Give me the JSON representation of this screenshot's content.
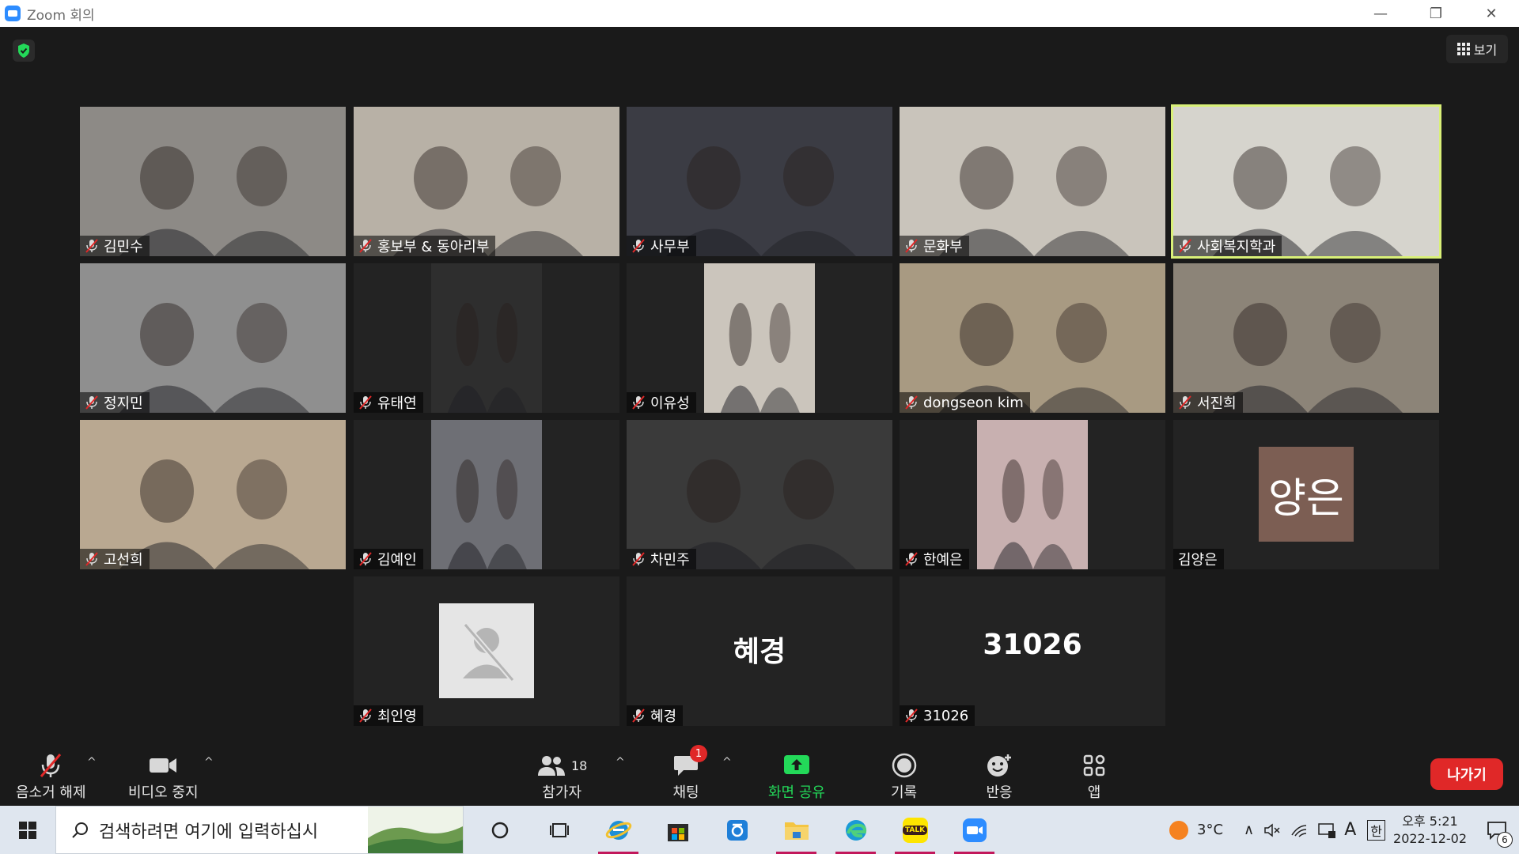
{
  "window": {
    "title": "Zoom 회의",
    "controls": [
      "—",
      "❐",
      "✕"
    ]
  },
  "header": {
    "view_label": "보기"
  },
  "participants": [
    {
      "name": "김민수",
      "type": "video",
      "bg": "#8d8a86"
    },
    {
      "name": "홍보부 & 동아리부",
      "type": "video",
      "bg": "#b8b1a6"
    },
    {
      "name": "사무부",
      "type": "video",
      "bg": "#3b3c44"
    },
    {
      "name": "문화부",
      "type": "video",
      "bg": "#c9c4bb"
    },
    {
      "name": "사회복지학과",
      "type": "video",
      "bg": "#d6d4cd",
      "active": true
    },
    {
      "name": "정지민",
      "type": "video",
      "bg": "#8f8f8f"
    },
    {
      "name": "유태연",
      "type": "video",
      "bg": "#2e2e2e",
      "narrow": true
    },
    {
      "name": "이유성",
      "type": "video",
      "bg": "#cbc5bc",
      "narrow": true
    },
    {
      "name": "dongseon kim",
      "type": "video",
      "bg": "#a89a82"
    },
    {
      "name": "서진희",
      "type": "video",
      "bg": "#8c8478"
    },
    {
      "name": "고선희",
      "type": "video",
      "bg": "#b9a891"
    },
    {
      "name": "김예인",
      "type": "video",
      "bg": "#6e6f75",
      "narrow": true
    },
    {
      "name": "차민주",
      "type": "video",
      "bg": "#3a3a3a"
    },
    {
      "name": "한예은",
      "type": "video",
      "bg": "#c8b0b0",
      "narrow": true
    },
    {
      "name": "김양은",
      "type": "avatar",
      "avatar_text": "양은"
    },
    {
      "name": "최인영",
      "type": "placeholder"
    },
    {
      "name": "혜경",
      "type": "bigname",
      "big_text": "혜경"
    },
    {
      "name": "31026",
      "type": "bigname",
      "big_text": "31026"
    }
  ],
  "toolbar": {
    "unmute": "음소거 해제",
    "stop_video": "비디오 중지",
    "participants": "참가자",
    "participants_count": "18",
    "chat": "채팅",
    "chat_badge": "1",
    "share": "화면 공유",
    "record": "기록",
    "reactions": "반응",
    "apps": "앱",
    "leave": "나가기"
  },
  "taskbar": {
    "search_placeholder": "검색하려면 여기에 입력하십시",
    "weather": "3°C",
    "ime": "한",
    "ime_a": "A",
    "time": "오후 5:21",
    "date": "2022-12-02",
    "notif_count": "6",
    "kakao_label": "TALK"
  },
  "colors": {
    "accent_green": "#23d959",
    "active_speaker": "#d9f078",
    "leave_red": "#e02828",
    "zoom_blue": "#2d8cff"
  }
}
